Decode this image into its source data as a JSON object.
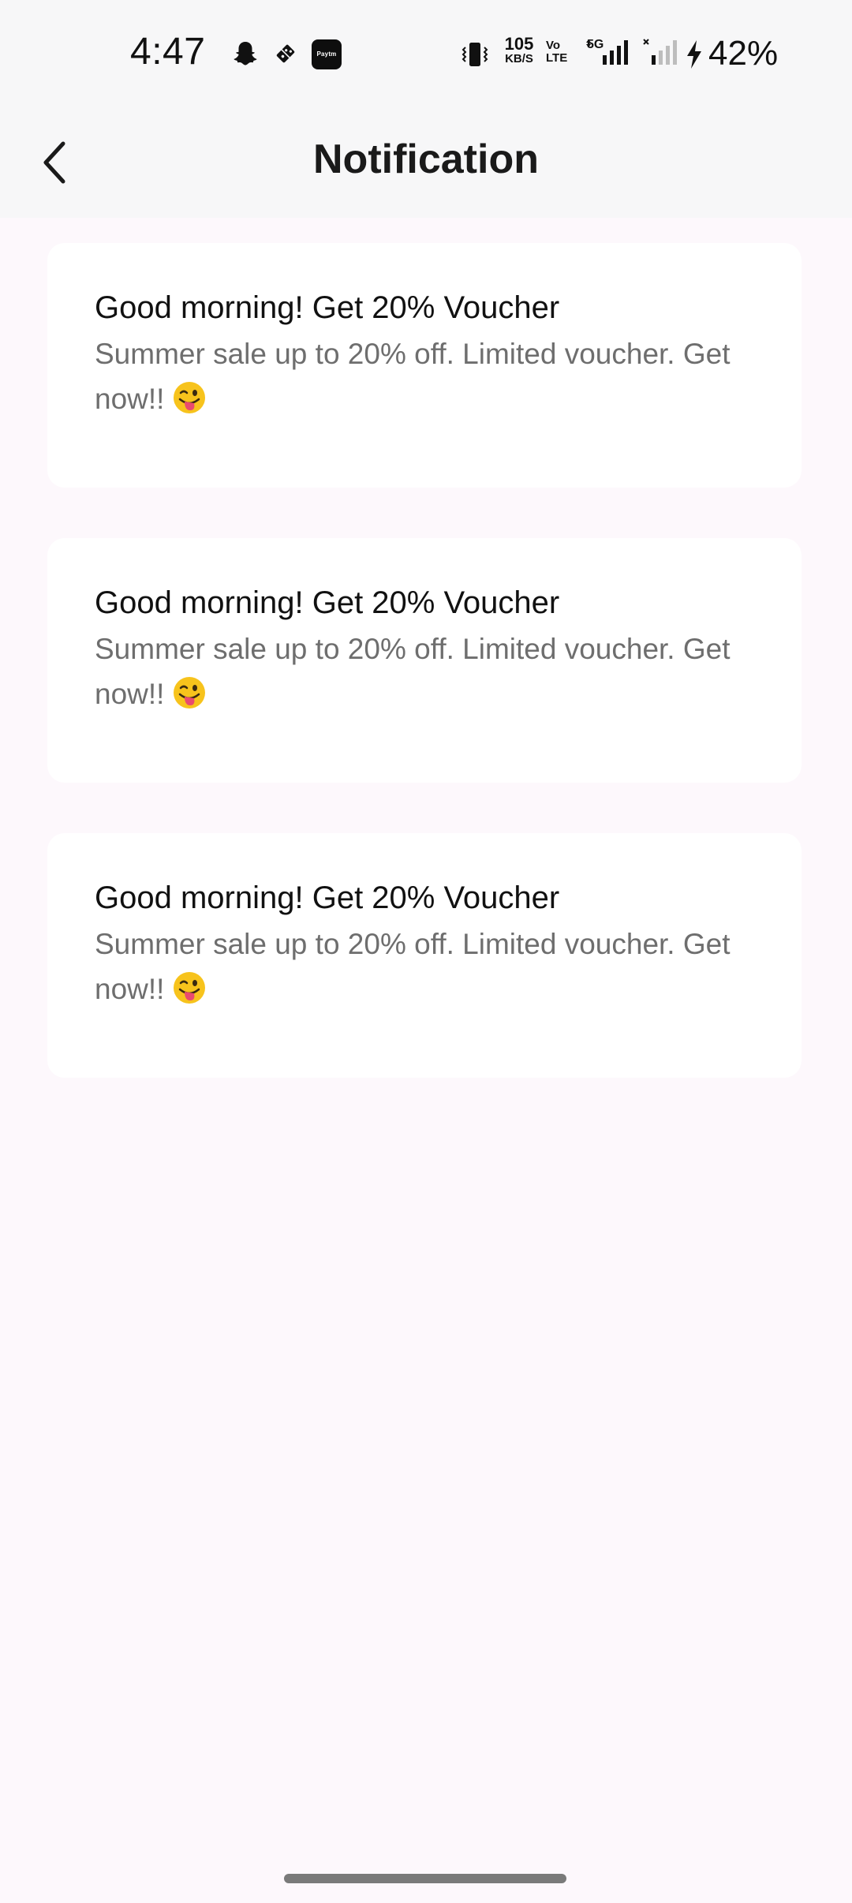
{
  "status_bar": {
    "time": "4:47",
    "net_speed_value": "105",
    "net_speed_unit": "KB/S",
    "volte_label": "Vo LTE",
    "network_type": "5G",
    "battery_percent": "42%",
    "icons": [
      "snapchat-icon",
      "dominos-icon",
      "paytm-icon",
      "vibrate-icon",
      "signal-icon",
      "charging-icon"
    ],
    "paytm_label": "Paytm"
  },
  "header": {
    "title": "Notification",
    "back_icon": "chevron-left-icon"
  },
  "notifications": [
    {
      "title": "Good morning! Get 20% Voucher",
      "body": "Summer sale up to 20% off. Limited voucher. Get now!!",
      "emoji": "winking-face-with-tongue"
    },
    {
      "title": "Good morning! Get 20% Voucher",
      "body": "Summer sale up to 20% off. Limited voucher. Get now!!",
      "emoji": "winking-face-with-tongue"
    },
    {
      "title": "Good morning! Get 20% Voucher",
      "body": "Summer sale up to 20% off. Limited voucher. Get now!!",
      "emoji": "winking-face-with-tongue"
    }
  ],
  "colors": {
    "background": "#FDF8FC",
    "card": "#FFFFFF",
    "title_text": "#111111",
    "body_text": "#6E6E6E"
  }
}
